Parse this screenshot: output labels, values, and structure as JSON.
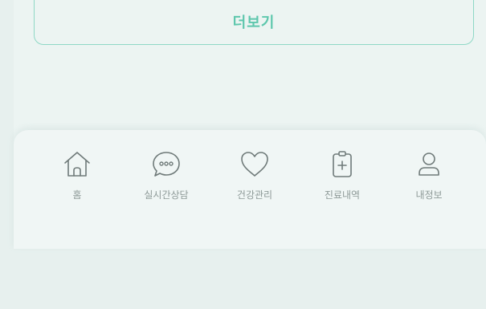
{
  "more_button": {
    "label": "더보기"
  },
  "tabbar": {
    "items": [
      {
        "label": "홈",
        "icon": "home-icon"
      },
      {
        "label": "실시간상담",
        "icon": "chat-bubble-icon"
      },
      {
        "label": "건강관리",
        "icon": "heart-icon"
      },
      {
        "label": "진료내역",
        "icon": "medical-clipboard-icon"
      },
      {
        "label": "내정보",
        "icon": "user-icon"
      }
    ]
  },
  "colors": {
    "accent": "#5ec7ad",
    "accent_border": "#8fd8c6",
    "icon_stroke": "#6f7a79",
    "tab_label": "#8e9a98",
    "background": "#e7f0ee"
  }
}
